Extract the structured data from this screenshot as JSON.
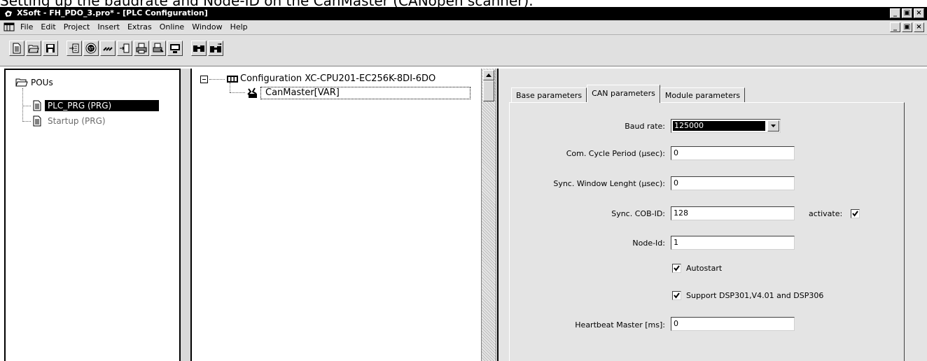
{
  "caption": "Setting up the baudrate and Node-ID on the CanMaster (CANopen scanner).",
  "window": {
    "title": "XSoft - FH_PDO_3.pro* - [PLC Configuration]",
    "buttons": [
      "_",
      "&#x25A1;",
      "×"
    ]
  },
  "menu": {
    "items": [
      "File",
      "Edit",
      "Project",
      "Insert",
      "Extras",
      "Online",
      "Window",
      "Help"
    ]
  },
  "pous": {
    "root": "POUs",
    "items": [
      {
        "label": "PLC_PRG (PRG)",
        "selected": true
      },
      {
        "label": "Startup (PRG)",
        "selected": false
      }
    ]
  },
  "config_tree": {
    "root": "Configuration XC-CPU201-EC256K-8DI-6DO",
    "child": "CanMaster[VAR]"
  },
  "tabs": [
    "Base parameters",
    "CAN parameters",
    "Module parameters"
  ],
  "active_tab": "CAN parameters",
  "form": {
    "baud_rate_label": "Baud rate:",
    "baud_rate_value": "125000",
    "com_cycle_label": "Com. Cycle Period (µsec):",
    "com_cycle_value": "0",
    "sync_window_label": "Sync. Window Lenght (µsec):",
    "sync_window_value": "0",
    "sync_cob_label": "Sync. COB-ID:",
    "sync_cob_value": "128",
    "activate_label": "activate:",
    "activate_checked": true,
    "node_id_label": "Node-Id:",
    "node_id_value": "1",
    "autostart_label": "Autostart",
    "autostart_checked": true,
    "support_label": "Support DSP301,V4.01 and DSP306",
    "support_checked": true,
    "heartbeat_label": "Heartbeat Master [ms]:",
    "heartbeat_value": "0"
  }
}
